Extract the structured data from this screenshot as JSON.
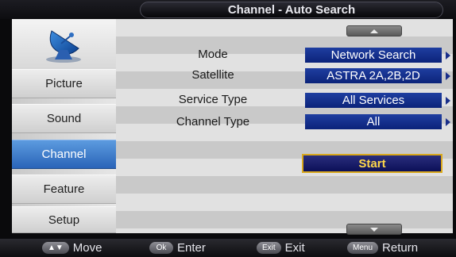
{
  "header": {
    "title": "Channel - Auto Search"
  },
  "sidebar": {
    "logo": "satellite-dish-icon",
    "items": [
      {
        "label": "Picture",
        "active": false
      },
      {
        "label": "Sound",
        "active": false
      },
      {
        "label": "Channel",
        "active": true
      },
      {
        "label": "Feature",
        "active": false
      },
      {
        "label": "Setup",
        "active": false
      }
    ]
  },
  "main": {
    "rows": [
      {
        "label": "Mode",
        "value": "Network Search"
      },
      {
        "label": "Satellite",
        "value": "ASTRA 2A,2B,2D"
      },
      {
        "label": "Service Type",
        "value": "All Services"
      },
      {
        "label": "Channel Type",
        "value": "All"
      }
    ],
    "start_label": "Start"
  },
  "footer": {
    "hints": [
      {
        "key": "▲▼",
        "label": "Move"
      },
      {
        "key": "Ok",
        "label": "Enter"
      },
      {
        "key": "Exit",
        "label": "Exit"
      },
      {
        "key": "Menu",
        "label": "Return"
      }
    ]
  },
  "colors": {
    "accent_active": "#3a7bd5",
    "value_box": "#14308c",
    "start_border": "#d9a81c"
  }
}
